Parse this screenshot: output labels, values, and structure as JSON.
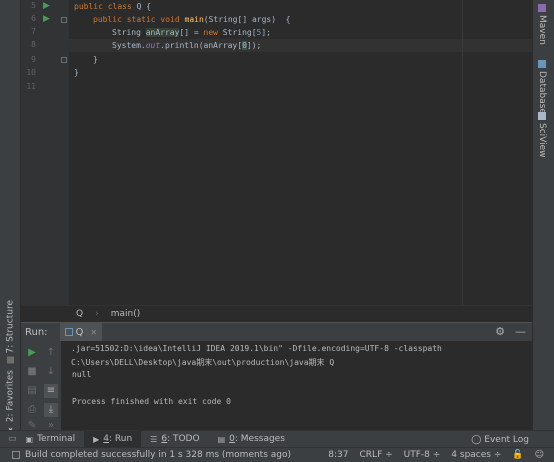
{
  "left_tool_tabs": [
    {
      "label": "7: Structure"
    },
    {
      "label": "2: Favorites"
    }
  ],
  "right_tool_tabs": [
    {
      "label": "Maven"
    },
    {
      "label": "Database"
    },
    {
      "label": "SciView"
    }
  ],
  "editor": {
    "line_numbers": [
      "5",
      "6",
      "7",
      "8",
      "9",
      "10",
      "11"
    ],
    "code": {
      "l5_kw": "public class ",
      "l5_name": "Q {",
      "l6_kw": "public static void ",
      "l6_fn": "main",
      "l6_rest": "(String[] args)  {",
      "l7_type": "String ",
      "l7_var": "anArray",
      "l7_mid": "[] = ",
      "l7_kw": "new ",
      "l7_type2": "String[",
      "l7_num": "5",
      "l7_end": "];",
      "l8_a": "System.",
      "l8_out": "out",
      "l8_b": ".println(anArray[",
      "l8_num": "0",
      "l8_c": "]);",
      "l9": "}",
      "l10": "}"
    }
  },
  "breadcrumb": {
    "items": [
      "Q",
      "main()"
    ]
  },
  "run_panel": {
    "label": "Run:",
    "tab_label": "Q",
    "console_lines": [
      ".jar=51502:D:\\idea\\IntelliJ IDEA 2019.1\\bin\" -Dfile.encoding=UTF-8 -classpath",
      "C:\\Users\\DELL\\Desktop\\java期末\\out\\production\\java期末 Q",
      "null",
      "",
      "Process finished with exit code 0"
    ]
  },
  "bottom_tabs": [
    {
      "num": "",
      "label": "Terminal"
    },
    {
      "num": "4",
      "label": ": Run"
    },
    {
      "num": "6",
      "label": ": TODO"
    },
    {
      "num": "0",
      "label": ": Messages"
    }
  ],
  "event_log": {
    "label": "Event Log"
  },
  "status": {
    "message": "Build completed successfully in 1 s 328 ms (moments ago)",
    "position": "8:37",
    "line_sep": "CRLF ÷",
    "encoding": "UTF-8 ÷",
    "indent": "4 spaces ÷"
  },
  "colors": {
    "editor_bg": "#2b2b2b",
    "panel_bg": "#3c3f41",
    "keyword": "#cc7832",
    "function": "#ffc66d",
    "number": "#6897bb",
    "field": "#9876aa",
    "run_green": "#499c54"
  },
  "icons": [
    "run-icon",
    "up-arrow-icon",
    "down-arrow-icon",
    "stop-icon",
    "soft-wrap-icon",
    "scroll-to-end-icon",
    "print-icon",
    "pin-icon",
    "gear-icon",
    "minimize-icon",
    "bubble-icon"
  ]
}
